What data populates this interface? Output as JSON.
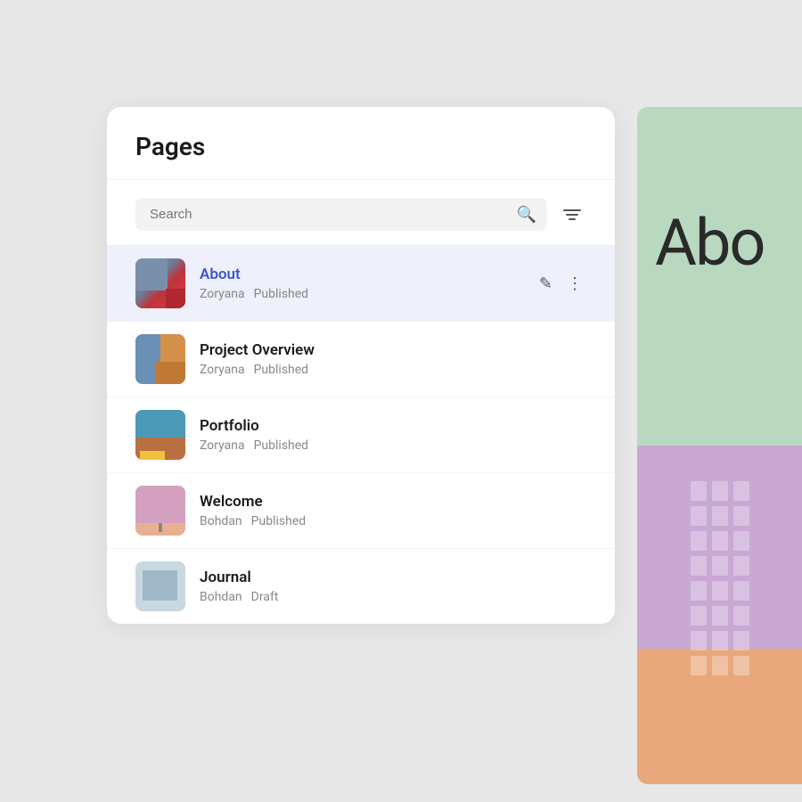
{
  "panel": {
    "title": "Pages"
  },
  "search": {
    "placeholder": "Search",
    "value": ""
  },
  "pages": [
    {
      "id": "about",
      "name": "About",
      "author": "Zoryana",
      "status": "Published",
      "active": true,
      "thumb_class": "thumb-about"
    },
    {
      "id": "project-overview",
      "name": "Project Overview",
      "author": "Zoryana",
      "status": "Published",
      "active": false,
      "thumb_class": "thumb-project"
    },
    {
      "id": "portfolio",
      "name": "Portfolio",
      "author": "Zoryana",
      "status": "Published",
      "active": false,
      "thumb_class": "thumb-portfolio"
    },
    {
      "id": "welcome",
      "name": "Welcome",
      "author": "Bohdan",
      "status": "Published",
      "active": false,
      "thumb_class": "thumb-welcome"
    },
    {
      "id": "journal",
      "name": "Journal",
      "author": "Bohdan",
      "status": "Draft",
      "active": false,
      "thumb_class": "thumb-journal"
    }
  ],
  "preview": {
    "title": "Abo"
  }
}
